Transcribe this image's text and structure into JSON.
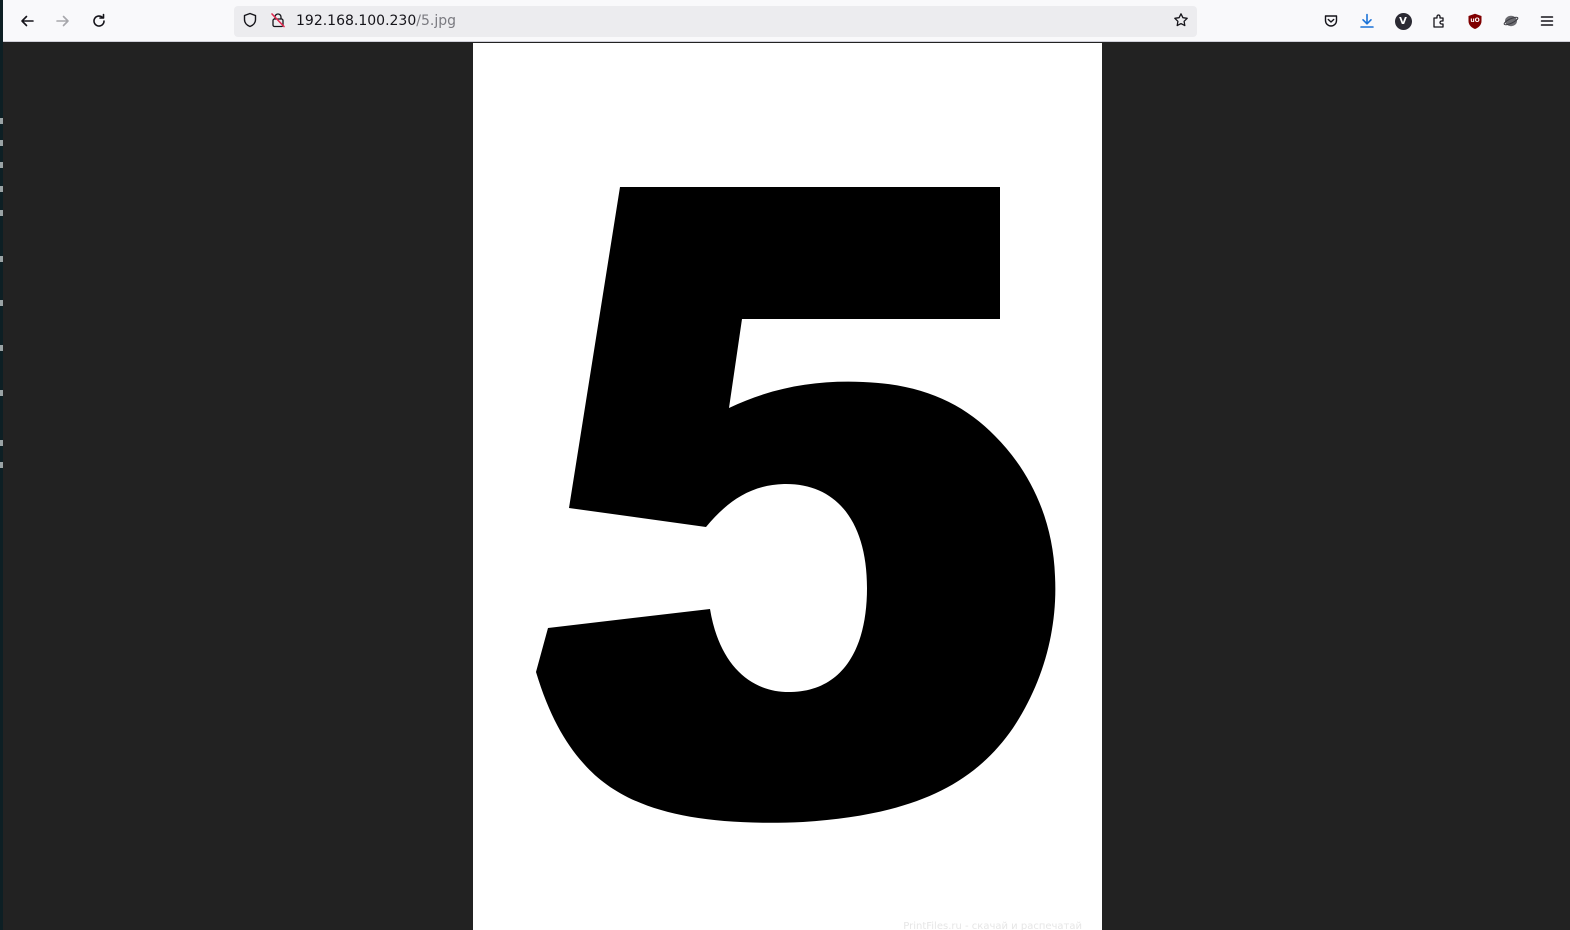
{
  "browser": {
    "url_host": "192.168.100.230",
    "url_path": "/5.jpg",
    "icons": {
      "back": "arrow-left-icon",
      "forward": "arrow-right-icon",
      "reload": "reload-icon",
      "tracking_protection": "shield-icon",
      "connection": "insecure-lock-icon",
      "bookmark": "star-icon",
      "pocket": "pocket-icon",
      "downloads": "download-icon",
      "extension_v": "v-extension-icon",
      "extensions": "puzzle-icon",
      "ublock": "ublock-origin-icon",
      "extension_other": "extension-icon",
      "menu": "hamburger-menu-icon"
    },
    "extension_v_letter": "V",
    "ublock_label": "uO"
  },
  "image": {
    "digit": "5",
    "watermark": "PrintFiles.ru - скачай и распечатай"
  },
  "colors": {
    "viewer_background": "#222222",
    "digit": "#000000",
    "page": "#ffffff",
    "download_accent": "#1c73d8",
    "ublock_red": "#800000"
  }
}
